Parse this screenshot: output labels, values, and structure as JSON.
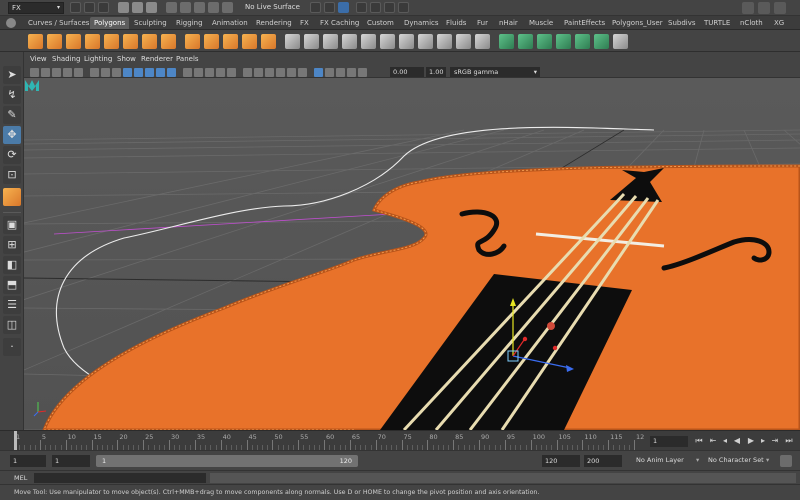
{
  "status_line": {
    "mode": "FX",
    "live_surface": "No Live Surface"
  },
  "shelf": {
    "tabs": [
      "Curves / Surfaces",
      "Polygons",
      "Sculpting",
      "Rigging",
      "Animation",
      "Rendering",
      "FX",
      "FX Caching",
      "Custom",
      "Dynamics",
      "Fluids",
      "Fur",
      "nHair",
      "Muscle",
      "PaintEffects",
      "Polygons_User",
      "Subdivs",
      "TURTLE",
      "nCloth",
      "XG"
    ],
    "active_tab": "Polygons",
    "icon_names": [
      "sphere-icon",
      "cube-icon",
      "cylinder-icon",
      "cone-icon",
      "plane-icon",
      "torus-icon",
      "pyramid-icon",
      "pipe-icon",
      "combine-icon",
      "separate-icon",
      "extract-icon",
      "smooth-icon",
      "boolean-icon",
      "mirror-icon",
      "bevel-icon",
      "bridge-icon",
      "extrude-icon",
      "append-icon",
      "split-icon",
      "insert-loop-icon",
      "offset-loop-icon",
      "slide-edge-icon",
      "merge-icon",
      "collapse-icon",
      "uv-editor-icon",
      "planar-map-icon",
      "auto-map-icon",
      "cylindrical-map-icon",
      "spherical-map-icon",
      "normals-icon",
      "checker-icon"
    ]
  },
  "panel": {
    "menus": [
      "View",
      "Shading",
      "Lighting",
      "Show",
      "Renderer",
      "Panels"
    ],
    "exposure": "0.00",
    "gamma": "1.00",
    "color_space": "sRGB gamma"
  },
  "time_slider": {
    "ticks": [
      "1",
      "5",
      "10",
      "15",
      "20",
      "25",
      "30",
      "35",
      "40",
      "45",
      "50",
      "55",
      "60",
      "65",
      "70",
      "75",
      "80",
      "85",
      "90",
      "95",
      "100",
      "105",
      "110",
      "115",
      "12"
    ],
    "current_frame": "1"
  },
  "range_slider": {
    "start_time": "1",
    "playback_start": "1",
    "range_start_label": "1",
    "range_end_label": "120",
    "playback_end": "120",
    "end_time": "200",
    "anim_layer": "No Anim Layer",
    "character_set": "No Character Set"
  },
  "command_line": {
    "label": "MEL"
  },
  "help_line": {
    "text": "Move Tool: Use manipulator to move object(s). Ctrl+MMB+drag to move components along normals. Use D or HOME to change the pivot position and axis orientation."
  },
  "colors": {
    "violin_body": "#e8722a",
    "violin_rim": "#c65a1a",
    "fingerboard": "#0d0d0d",
    "strings": "#e8dcb0",
    "viewport_bg": "#575757",
    "selection_blue": "#4b7ba8"
  }
}
